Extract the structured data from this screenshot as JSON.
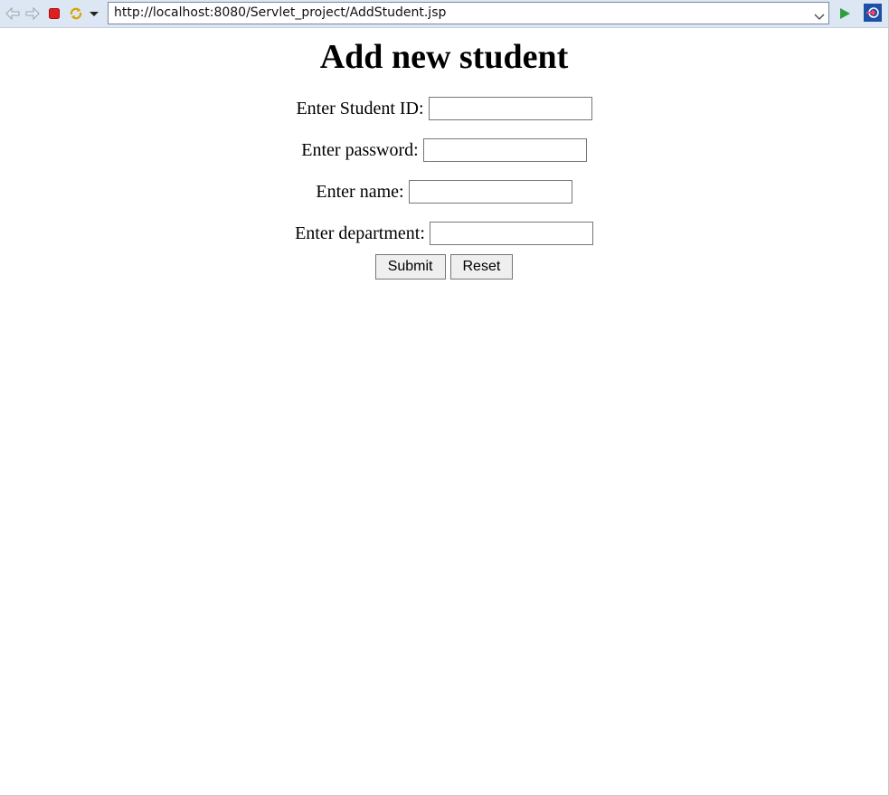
{
  "toolbar": {
    "back_icon": "back-arrow-icon",
    "forward_icon": "forward-arrow-icon",
    "stop_icon": "stop-icon",
    "refresh_icon": "refresh-icon",
    "menu_icon": "dropdown-arrow-icon",
    "url": "http://localhost:8080/Servlet_project/AddStudent.jsp",
    "go_icon": "go-play-icon",
    "external_icon": "open-external-browser-icon"
  },
  "page": {
    "title": "Add new student",
    "fields": [
      {
        "label": "Enter Student ID:",
        "value": ""
      },
      {
        "label": "Enter password:",
        "value": ""
      },
      {
        "label": "Enter name:",
        "value": ""
      },
      {
        "label": "Enter department:",
        "value": ""
      }
    ],
    "submit_label": "Submit",
    "reset_label": "Reset"
  },
  "colors": {
    "toolbar_bg": "#dde6f3",
    "stop_red": "#e02020",
    "go_green": "#2e9e3e",
    "external_blue": "#1e4fa8"
  }
}
